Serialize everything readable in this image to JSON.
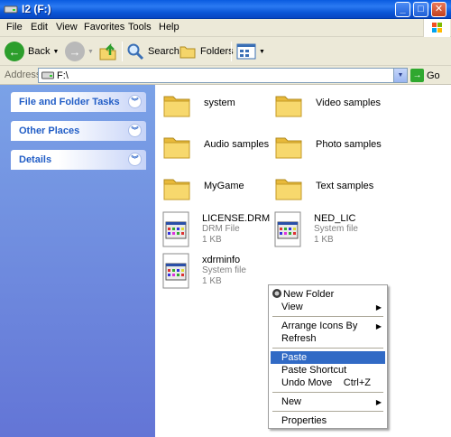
{
  "window": {
    "title": "I2 (F:)",
    "buttons": {
      "minimize": "_",
      "maximize": "□",
      "close": "✕"
    }
  },
  "menubar": [
    "File",
    "Edit",
    "View",
    "Favorites",
    "Tools",
    "Help"
  ],
  "toolbar": {
    "back": "Back",
    "search": "Search",
    "folders": "Folders"
  },
  "address": {
    "label": "Address",
    "path": "F:\\",
    "go": "Go"
  },
  "tasks": [
    {
      "title": "File and Folder Tasks"
    },
    {
      "title": "Other Places"
    },
    {
      "title": "Details"
    }
  ],
  "folders": [
    "system",
    "Video samples",
    "Audio samples",
    "Photo samples",
    "MyGame",
    "Text samples"
  ],
  "files": [
    {
      "name": "LICENSE.DRM",
      "type": "DRM File",
      "size": "1 KB"
    },
    {
      "name": "NED_LIC",
      "type": "System file",
      "size": "1 KB"
    },
    {
      "name": "xdrminfo",
      "type": "System file",
      "size": "1 KB"
    }
  ],
  "context_menu": {
    "new_folder": "New Folder",
    "view": "View",
    "arrange": "Arrange Icons By",
    "refresh": "Refresh",
    "paste": "Paste",
    "paste_shortcut": "Paste Shortcut",
    "undo_move": "Undo Move",
    "undo_shortcut": "Ctrl+Z",
    "new": "New",
    "properties": "Properties"
  },
  "colors": {
    "titlebar": "#0a55d6",
    "left_pane": "#7ba2e7",
    "highlight": "#316ac5",
    "folder": "#f5d56a"
  }
}
